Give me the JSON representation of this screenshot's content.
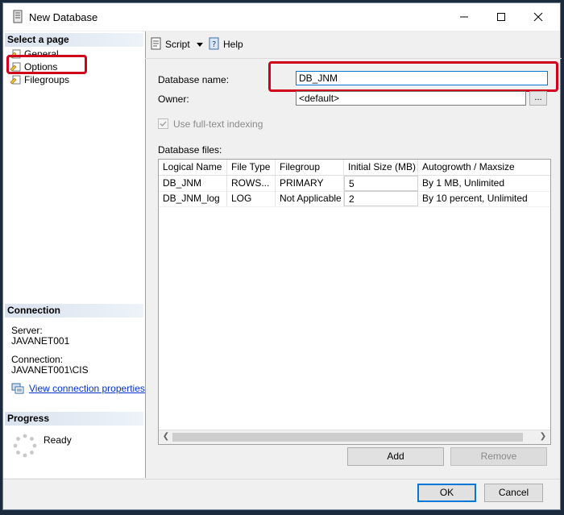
{
  "window": {
    "title": "New Database",
    "controls": [
      "minimize",
      "maximize",
      "close"
    ]
  },
  "left": {
    "select_page_header": "Select a page",
    "pages": [
      {
        "label": "General",
        "icon": "page-icon"
      },
      {
        "label": "Options",
        "icon": "page-icon"
      },
      {
        "label": "Filegroups",
        "icon": "page-icon"
      }
    ],
    "connection_header": "Connection",
    "server_label": "Server:",
    "server_value": "JAVANET001",
    "connection_label": "Connection:",
    "connection_value": "JAVANET001\\CIS",
    "view_connection_link": "View connection properties",
    "progress_header": "Progress",
    "progress_status": "Ready"
  },
  "toolbar": {
    "script_label": "Script",
    "help_label": "Help"
  },
  "form": {
    "db_name_label": "Database name:",
    "db_name_value": "DB_JNM",
    "owner_label": "Owner:",
    "owner_value": "<default>",
    "browse_label": "...",
    "fulltext_label": "Use full-text indexing",
    "db_files_label": "Database files:"
  },
  "grid": {
    "columns": [
      "Logical Name",
      "File Type",
      "Filegroup",
      "Initial Size (MB)",
      "Autogrowth / Maxsize"
    ],
    "rows": [
      [
        "DB_JNM",
        "ROWS...",
        "PRIMARY",
        "5",
        "By 1 MB, Unlimited"
      ],
      [
        "DB_JNM_log",
        "LOG",
        "Not Applicable",
        "2",
        "By 10 percent, Unlimited"
      ]
    ]
  },
  "buttons": {
    "add": "Add",
    "remove": "Remove",
    "ok": "OK",
    "cancel": "Cancel"
  },
  "colors": {
    "highlight_red": "#d0021b",
    "link_blue": "#0033cc",
    "focus_blue": "#0078d7"
  }
}
